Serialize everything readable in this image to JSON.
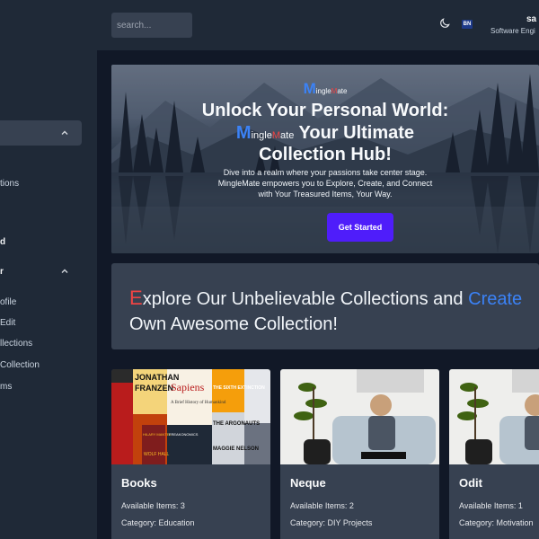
{
  "header": {
    "search_placeholder": "search...",
    "language_badge": "BN",
    "user_name": "sa",
    "user_role": "Software Engi"
  },
  "sidebar": {
    "items": [
      {
        "label": "tions",
        "style": "normal"
      },
      {
        "label": "d",
        "style": "bold"
      },
      {
        "label": "r",
        "style": "bold"
      },
      {
        "label": "ofile",
        "style": "normal"
      },
      {
        "label": "Edit",
        "style": "normal"
      },
      {
        "label": "llections",
        "style": "normal"
      },
      {
        "label": "Collection",
        "style": "normal"
      },
      {
        "label": "ms",
        "style": "normal"
      }
    ]
  },
  "hero": {
    "logo": {
      "first": "M",
      "part1": "ingle",
      "second": "M",
      "part2": "ate"
    },
    "headline_line1": "Unlock Your Personal World:",
    "headline_line2_suffix": "Your Ultimate",
    "headline_line3": "Collection Hub!",
    "description": "Dive into a realm where your passions take center stage. MingleMate empowers you to Explore, Create, and Connect with Your Treasured Items, Your Way.",
    "cta_label": "Get Started"
  },
  "explore": {
    "first_letter": "E",
    "text_before": "xplore Our Unbelievable Collections and",
    "highlight": "Create",
    "line2": "Own Awesome Collection!"
  },
  "cards": [
    {
      "title": "Books",
      "available": "Available Items: 3",
      "category": "Category: Education"
    },
    {
      "title": "Neque",
      "available": "Available Items: 2",
      "category": "Category: DIY Projects"
    },
    {
      "title": "Odit",
      "available": "Available Items: 1",
      "category": "Category: Motivation"
    }
  ],
  "book_covers": [
    "JONATHAN",
    "FRANZEN",
    "Sapiens",
    "A Brief History of Humankind",
    "THE SIXTH EXTINCTION",
    "MAGGIE NELSON",
    "THE ARGONAUTS",
    "HILARY MANTEL",
    "WOLF HALL",
    "FREAKONOMICS"
  ],
  "colors": {
    "accent_blue": "#3b82f6",
    "accent_red": "#ef4444",
    "cta_purple": "#4f1dfa",
    "panel": "#374151",
    "background": "#111827"
  },
  "icons": [
    "moon-icon",
    "chevron-up-icon"
  ]
}
